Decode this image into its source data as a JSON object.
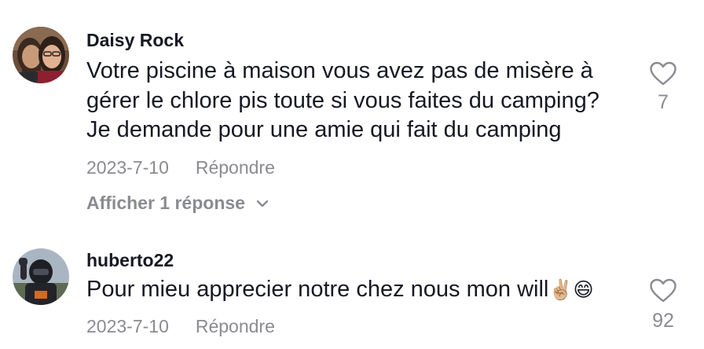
{
  "comments": [
    {
      "username": "Daisy Rock",
      "text": "Votre piscine à maison vous avez pas de misère à\ngérer le chlore pis toute si vous faites du camping?\nJe demande pour une amie qui fait du camping",
      "date": "2023-7-10",
      "reply_label": "Répondre",
      "view_replies": "Afficher 1 réponse",
      "likes": "7",
      "avatar_icon": "couple-selfie-avatar"
    },
    {
      "username": "huberto22",
      "text": "Pour mieu apprecier notre chez nous mon will",
      "emojis": "✌🏼😄",
      "date": "2023-7-10",
      "reply_label": "Répondre",
      "likes": "92",
      "avatar_icon": "rider-helmet-avatar"
    }
  ],
  "colors": {
    "primary_text": "#161823",
    "secondary_text": "#8a8b91",
    "background": "#ffffff"
  }
}
